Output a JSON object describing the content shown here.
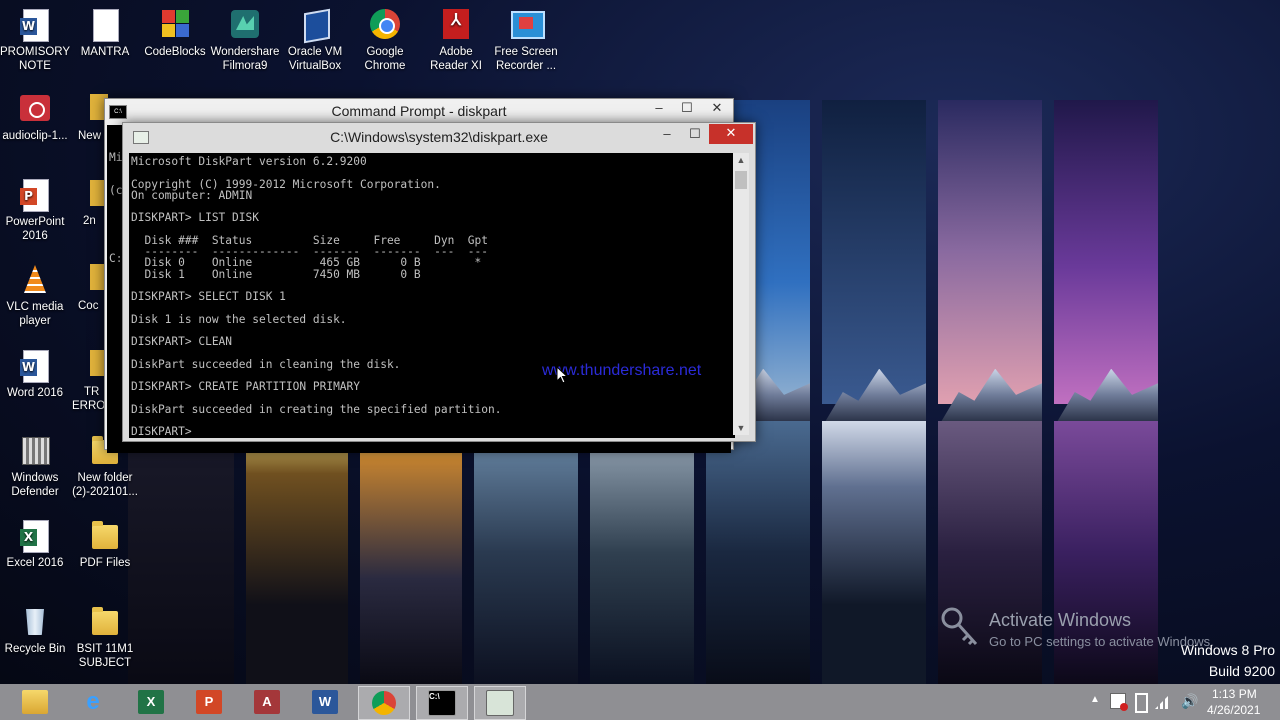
{
  "desktop": {
    "icons": [
      {
        "label": "PROMISORY\nNOTE",
        "icon": "word-document-icon",
        "color": "#2b579a",
        "glyph": "W"
      },
      {
        "label": "MANTRA",
        "icon": "blank-document-icon",
        "color": "#ffffff",
        "glyph": ""
      },
      {
        "label": "CodeBlocks",
        "icon": "codeblocks-icon",
        "color": "#e03a2f",
        "glyph": ""
      },
      {
        "label": "Wondershare\nFilmora9",
        "icon": "filmora-icon",
        "color": "#1f6f6f",
        "glyph": ""
      },
      {
        "label": "Oracle VM\nVirtualBox",
        "icon": "virtualbox-icon",
        "color": "#1c4e9c",
        "glyph": ""
      },
      {
        "label": "Google\nChrome",
        "icon": "chrome-icon",
        "color": "#e3a21a",
        "glyph": ""
      },
      {
        "label": "Adobe\nReader XI",
        "icon": "adobe-reader-icon",
        "color": "#c41e1e",
        "glyph": ""
      },
      {
        "label": "Free Screen\nRecorder ...",
        "icon": "screen-recorder-icon",
        "color": "#2a8fd6",
        "glyph": ""
      },
      {
        "label": "audioclip-1...",
        "icon": "audio-clip-icon",
        "color": "#c9303a",
        "glyph": ""
      },
      {
        "label": "PowerPoint\n2016",
        "icon": "powerpoint-icon",
        "color": "#d24726",
        "glyph": "P"
      },
      {
        "label": "VLC media\nplayer",
        "icon": "vlc-icon",
        "color": "#f08a1c",
        "glyph": ""
      },
      {
        "label": "Word 2016",
        "icon": "word-icon",
        "color": "#2b579a",
        "glyph": "W"
      },
      {
        "label": "Windows\nDefender",
        "icon": "windows-defender-icon",
        "color": "#777777",
        "glyph": ""
      },
      {
        "label": "New folder\n(2)-202101...",
        "icon": "folder-icon",
        "color": "#e8c24c",
        "glyph": ""
      },
      {
        "label": "Excel 2016",
        "icon": "excel-icon",
        "color": "#217346",
        "glyph": "X"
      },
      {
        "label": "PDF Files",
        "icon": "folder-icon",
        "color": "#e8c24c",
        "glyph": ""
      },
      {
        "label": "Recycle Bin",
        "icon": "recycle-bin-icon",
        "color": "#9fb8d0",
        "glyph": ""
      },
      {
        "label": "BSIT 11M1\nSUBJECT",
        "icon": "folder-icon",
        "color": "#e8c24c",
        "glyph": ""
      }
    ],
    "partial_labels": [
      "New",
      "2n",
      "Coc",
      "TR",
      "ERRO"
    ]
  },
  "back_window": {
    "title": "Command Prompt - diskpart",
    "console_fragments": [
      "Mi",
      "(c",
      "C:"
    ]
  },
  "front_window": {
    "title": "C:\\Windows\\system32\\diskpart.exe",
    "console_lines": [
      "Microsoft DiskPart version 6.2.9200",
      "",
      "Copyright (C) 1999-2012 Microsoft Corporation.",
      "On computer: ADMIN",
      "",
      "DISKPART> LIST DISK",
      "",
      "  Disk ###  Status         Size     Free     Dyn  Gpt",
      "  --------  -------------  -------  -------  ---  ---",
      "  Disk 0    Online          465 GB      0 B        *",
      "  Disk 1    Online         7450 MB      0 B",
      "",
      "DISKPART> SELECT DISK 1",
      "",
      "Disk 1 is now the selected disk.",
      "",
      "DISKPART> CLEAN",
      "",
      "DiskPart succeeded in cleaning the disk.",
      "",
      "DISKPART> CREATE PARTITION PRIMARY",
      "",
      "DiskPart succeeded in creating the specified partition.",
      "",
      "DISKPART>"
    ]
  },
  "watermark": {
    "site": "www.thundershare.net",
    "activate_title": "Activate Windows",
    "activate_sub": "Go to PC settings to activate Windows.",
    "edition": "Windows 8 Pro",
    "build": "Build 9200"
  },
  "taskbar": {
    "items": [
      {
        "name": "file-explorer-icon",
        "color": "#e8c24c",
        "glyph": ""
      },
      {
        "name": "internet-explorer-icon",
        "color": "#1e88e5",
        "glyph": "e"
      },
      {
        "name": "excel-taskbar-icon",
        "color": "#217346",
        "glyph": "X"
      },
      {
        "name": "powerpoint-taskbar-icon",
        "color": "#d24726",
        "glyph": "P"
      },
      {
        "name": "access-taskbar-icon",
        "color": "#a4373a",
        "glyph": "A"
      },
      {
        "name": "word-taskbar-icon",
        "color": "#2b579a",
        "glyph": "W"
      },
      {
        "name": "chrome-taskbar-icon",
        "color": "#e3a21a",
        "glyph": ""
      },
      {
        "name": "command-prompt-taskbar-icon",
        "color": "#000000",
        "glyph": "C:\\"
      },
      {
        "name": "diskpart-taskbar-icon",
        "color": "#d8e4d8",
        "glyph": ""
      }
    ],
    "time": "1:13 PM",
    "date": "4/26/2021"
  }
}
